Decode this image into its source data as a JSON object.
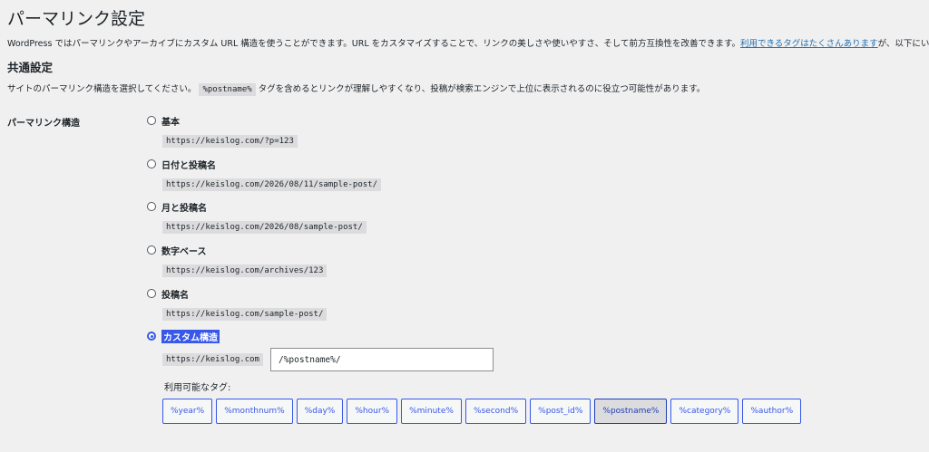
{
  "page": {
    "title": "パーマリンク設定",
    "intro_text": "WordPress ではパーマリンクやアーカイブにカスタム URL 構造を使うことができます。URL をカスタマイズすることで、リンクの美しさや使いやすさ、そして前方互換性を改善できます。",
    "intro_link": "利用できるタグはたくさんあります",
    "intro_tail": "が、以下にいくつか試して"
  },
  "common": {
    "section_title": "共通設定",
    "desc_before": "サイトのパーマリンク構造を選択してください。",
    "desc_code": "%postname%",
    "desc_after": " タグを含めるとリンクが理解しやすくなり、投稿が検索エンジンで上位に表示されるのに役立つ可能性があります。",
    "row_label": "パーマリンク構造"
  },
  "options": [
    {
      "label": "基本",
      "url": "https://keislog.com/?p=123",
      "checked": false
    },
    {
      "label": "日付と投稿名",
      "url": "https://keislog.com/2026/08/11/sample-post/",
      "checked": false
    },
    {
      "label": "月と投稿名",
      "url": "https://keislog.com/2026/08/sample-post/",
      "checked": false
    },
    {
      "label": "数字ベース",
      "url": "https://keislog.com/archives/123",
      "checked": false
    },
    {
      "label": "投稿名",
      "url": "https://keislog.com/sample-post/",
      "checked": false
    },
    {
      "label": "カスタム構造",
      "checked": true
    }
  ],
  "custom": {
    "base": "https://keislog.com",
    "value": "/%postname%/",
    "tags_label": "利用可能なタグ:"
  },
  "tags": [
    "%year%",
    "%monthnum%",
    "%day%",
    "%hour%",
    "%minute%",
    "%second%",
    "%post_id%",
    "%postname%",
    "%category%",
    "%author%"
  ],
  "active_tag": "%postname%",
  "colors": {
    "accent": "#3858e9",
    "link": "#2271b1",
    "background": "#f0f0f1"
  }
}
